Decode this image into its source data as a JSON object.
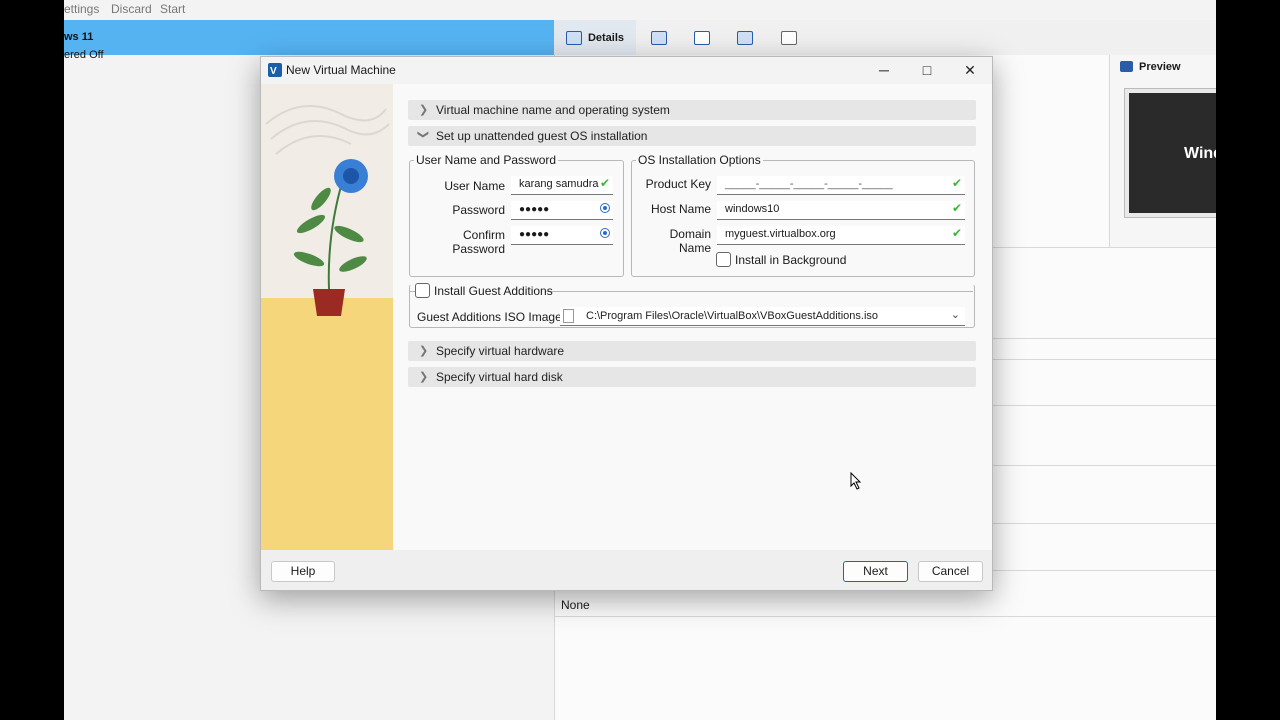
{
  "bg": {
    "toolbar": [
      "ettings",
      "Discard",
      "Start"
    ],
    "vm_name": "ws 11",
    "vm_state": "ered Off",
    "tabs": {
      "details": "Details"
    },
    "preview_label": "Preview",
    "preview_text": "Wind",
    "none_label": "None"
  },
  "dialog": {
    "title": "New Virtual Machine",
    "sections": {
      "name_os": "Virtual machine name and operating system",
      "unattended": "Set up unattended guest OS installation",
      "hardware": "Specify virtual hardware",
      "disk": "Specify virtual hard disk"
    },
    "user_group": {
      "legend": "User Name and Password",
      "user_label": "User Name",
      "user_value": "karang samudra",
      "password_label": "Password",
      "password_value": "●●●●●",
      "confirm_label": "Confirm Password",
      "confirm_value": "●●●●●"
    },
    "os_group": {
      "legend": "OS Installation Options",
      "product_key_label": "Product Key",
      "product_key_value": "_____-_____-_____-_____-_____",
      "host_label": "Host Name",
      "host_value": "windows10",
      "domain_label": "Domain Name",
      "domain_value": "myguest.virtualbox.org",
      "background_label": "Install in Background"
    },
    "guest": {
      "checkbox_label": "Install Guest Additions",
      "iso_label": "Guest Additions ISO Image:",
      "iso_value": "C:\\Program Files\\Oracle\\VirtualBox\\VBoxGuestAdditions.iso"
    },
    "buttons": {
      "help": "Help",
      "next": "Next",
      "cancel": "Cancel"
    }
  },
  "colors": {
    "accent": "#56b3f2",
    "valid": "#3db53d",
    "art_floor": "#f5d67b"
  }
}
